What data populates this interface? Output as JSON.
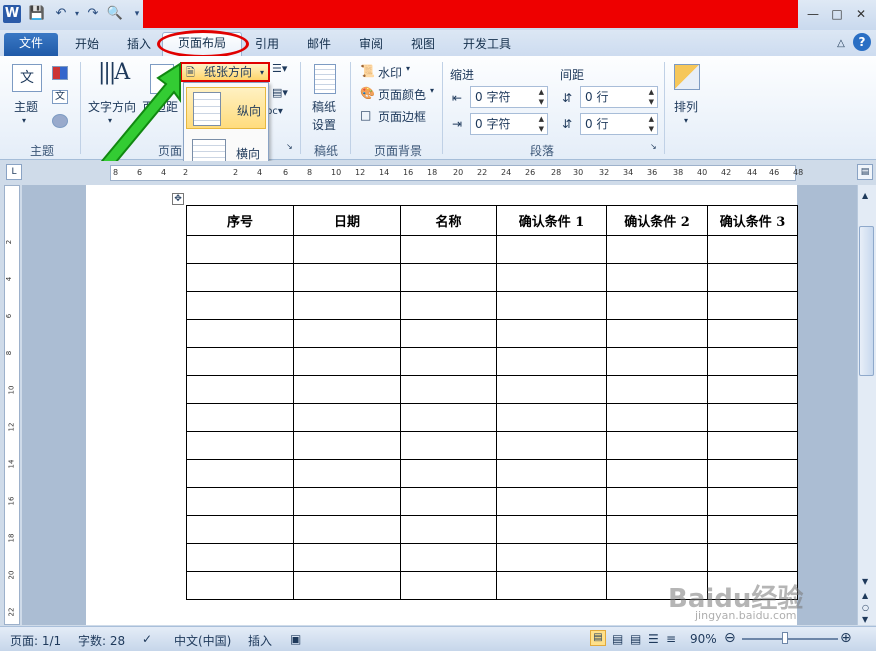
{
  "app": {
    "logo": "W"
  },
  "quick_access": {
    "icons": [
      "save-icon",
      "undo-icon",
      "redo-icon",
      "print-preview-icon",
      "customize-icon"
    ]
  },
  "tabs": [
    "文件",
    "开始",
    "插入",
    "页面布局",
    "引用",
    "邮件",
    "审阅",
    "视图",
    "开发工具"
  ],
  "ribbon": {
    "themes": {
      "button": "主题",
      "group": "主题",
      "theme_icon_text": "文"
    },
    "page_setup": {
      "text_direction": "文字方向",
      "margins": "页边距",
      "orientation": "纸张方向",
      "group": "页面"
    },
    "manuscript": {
      "button1": "稿纸",
      "button2": "设置",
      "group": "稿纸"
    },
    "page_background": {
      "watermark": "水印",
      "page_color": "页面颜色",
      "page_border": "页面边框",
      "group": "页面背景"
    },
    "paragraph": {
      "indent_label": "缩进",
      "spacing_label": "间距",
      "indent_left": "0 字符",
      "indent_right": "0 字符",
      "spacing_before": "0 行",
      "spacing_after": "0 行",
      "group": "段落"
    },
    "arrange": {
      "button": "排列"
    }
  },
  "orientation_menu": {
    "items": [
      "纵向",
      "横向"
    ]
  },
  "ruler": {
    "h_ticks": [
      "8",
      "6",
      "4",
      "2",
      "2",
      "4",
      "6",
      "8",
      "10",
      "12",
      "14",
      "16",
      "18",
      "20",
      "22",
      "24",
      "26",
      "28",
      "30",
      "32",
      "34",
      "36",
      "38",
      "40",
      "42",
      "44",
      "46",
      "48"
    ],
    "v_ticks": [
      "2",
      "4",
      "6",
      "8",
      "10",
      "12",
      "14",
      "16",
      "18",
      "20",
      "22"
    ]
  },
  "table": {
    "headers": [
      "序号",
      "日期",
      "名称",
      "确认条件 1",
      "确认条件 2",
      "确认条件 3"
    ],
    "row_count": 13
  },
  "status": {
    "page": "页面: 1/1",
    "words": "字数: 28",
    "language": "中文(中国)",
    "insert": "插入",
    "zoom": "90%"
  },
  "watermark": {
    "brand": "Baidu经验",
    "url": "jingyan.baidu.com"
  },
  "colors": {
    "accent": "#1f5aa8",
    "highlight": "#ffd56b",
    "annotation_red": "#e00000",
    "annotation_green": "#33cc33"
  }
}
